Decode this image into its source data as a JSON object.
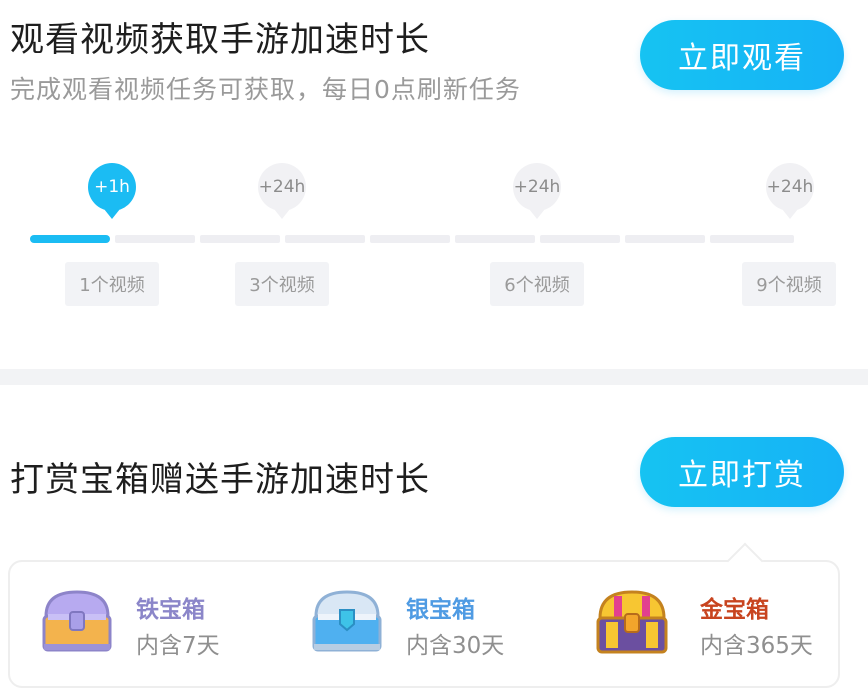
{
  "video_task": {
    "title": "观看视频获取手游加速时长",
    "subtitle": "完成观看视频任务可获取，每日0点刷新任务",
    "button_label": "立即观看",
    "progress_fraction": 0.111,
    "milestones": [
      {
        "reward": "+1h",
        "label": "1个视频",
        "reached": true
      },
      {
        "reward": "+24h",
        "label": "3个视频",
        "reached": false
      },
      {
        "reward": "+24h",
        "label": "6个视频",
        "reached": false
      },
      {
        "reward": "+24h",
        "label": "9个视频",
        "reached": false
      }
    ]
  },
  "reward_task": {
    "title": "打赏宝箱赠送手游加速时长",
    "button_label": "立即打赏",
    "chests": [
      {
        "name": "铁宝箱",
        "desc": "内含7天",
        "icon": "iron-chest-icon",
        "name_color": "#8b86c9"
      },
      {
        "name": "银宝箱",
        "desc": "内含30天",
        "icon": "silver-chest-icon",
        "name_color": "#4f9be3"
      },
      {
        "name": "金宝箱",
        "desc": "内含365天",
        "icon": "gold-chest-icon",
        "name_color": "#c8441f"
      }
    ]
  },
  "colors": {
    "accent": "#1bbcf3",
    "track": "#eeeef2"
  }
}
